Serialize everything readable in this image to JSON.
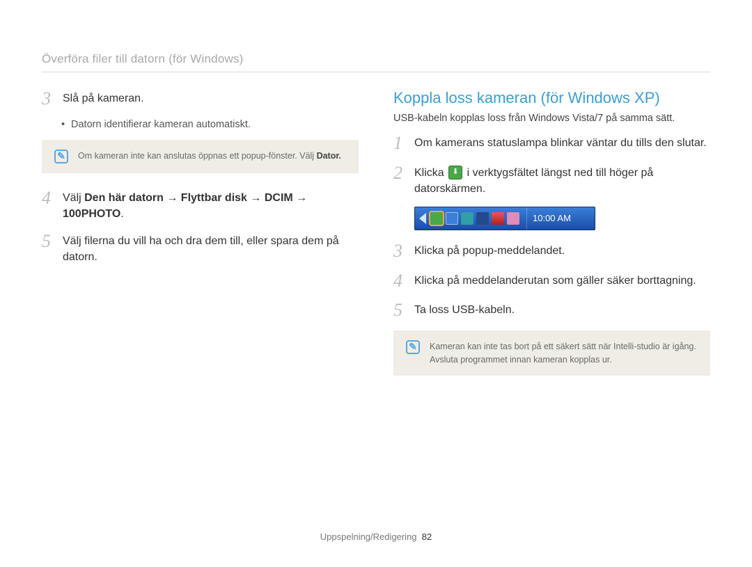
{
  "header": "Överföra filer till datorn (för Windows)",
  "left": {
    "step3": {
      "num": "3",
      "text": "Slå på kameran.",
      "sub": "Datorn identifierar kameran automatiskt."
    },
    "note1_a": "Om kameran inte kan anslutas öppnas ett popup-fönster. Välj ",
    "note1_b": "Dator.",
    "step4": {
      "num": "4",
      "prefix": "Välj ",
      "bold": "Den här datorn → Flyttbar disk → DCIM → 100PHOTO",
      "suffix": "."
    },
    "step5": {
      "num": "5",
      "text": "Välj filerna du vill ha och dra dem till, eller spara dem på datorn."
    }
  },
  "right": {
    "title": "Koppla loss kameran (för Windows XP)",
    "intro": "USB-kabeln kopplas loss från Windows Vista/7 på samma sätt.",
    "step1": {
      "num": "1",
      "text": "Om kamerans statuslampa blinkar väntar du tills den slutar."
    },
    "step2": {
      "num": "2",
      "prefix": "Klicka ",
      "suffix": " i verktygsfältet längst ned till höger på datorskärmen."
    },
    "tray_time": "10:00 AM",
    "step3": {
      "num": "3",
      "text": "Klicka på popup-meddelandet."
    },
    "step4": {
      "num": "4",
      "text": "Klicka på meddelanderutan som gäller säker borttagning."
    },
    "step5": {
      "num": "5",
      "text": "Ta loss USB-kabeln."
    },
    "note2": "Kameran kan inte tas bort på ett säkert sätt när Intelli-studio är igång. Avsluta programmet innan kameran kopplas ur."
  },
  "footer": {
    "section": "Uppspelning/Redigering",
    "page": "82"
  }
}
